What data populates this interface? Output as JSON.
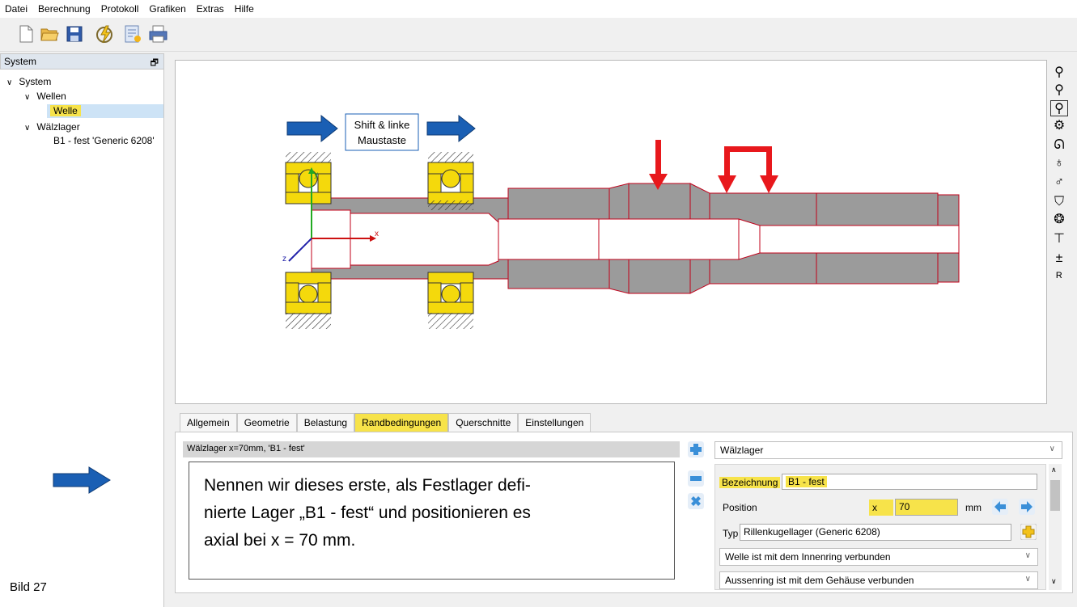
{
  "menu": [
    "Datei",
    "Berechnung",
    "Protokoll",
    "Grafiken",
    "Extras",
    "Hilfe"
  ],
  "toolbar_icons": [
    "new-file-icon",
    "open-folder-icon",
    "save-icon",
    "calculate-icon",
    "report-icon",
    "print-icon"
  ],
  "tree": {
    "panel_title": "System",
    "root": "System",
    "wellen": "Wellen",
    "welle": "Welle",
    "waelzlager": "Wälzlager",
    "bearing_item": "B1 - fest 'Generic 6208'"
  },
  "canvas": {
    "hint_line1": "Shift & linke",
    "hint_line2": "Maustaste",
    "axis_x": "x",
    "axis_y": "y",
    "axis_z": "z"
  },
  "right_tools": [
    "zoom-in-icon",
    "zoom-out-icon",
    "zoom-window-icon",
    "gear-icon",
    "bearing-icon",
    "force-icon",
    "moment-icon",
    "support-icon",
    "ball-bearing-icon",
    "section-icon",
    "coupling-icon",
    "results-icon"
  ],
  "tabs": [
    "Allgemein",
    "Geometrie",
    "Belastung",
    "Randbedingungen",
    "Querschnitte",
    "Einstellungen"
  ],
  "active_tab": "Randbedingungen",
  "list_header": "Wälzlager  x=70mm, 'B1 - fest'",
  "note_text": [
    "Nennen wir dieses erste, als Festlager defi-",
    "nierte Lager „B1 - fest“ und positionieren es",
    "axial bei x = 70 mm."
  ],
  "element_type": "Wälzlager",
  "form": {
    "bezeichnung_label": "Bezeichnung",
    "bezeichnung_value": "B1 - fest",
    "position_label": "Position",
    "x_label": "x",
    "x_value": "70",
    "unit": "mm",
    "typ_label": "Typ",
    "typ_value": "Rillenkugellager (Generic 6208)",
    "inner_option": "Welle ist mit dem Innenring verbunden",
    "outer_option": "Aussenring ist mit dem Gehäuse verbunden"
  },
  "caption": "Bild 27",
  "colors": {
    "highlight": "#f7e34a",
    "arrow_blue": "#1a5fb4",
    "load_red": "#e8181c",
    "shaft_gray": "#9b9b9b",
    "bearing_yellow": "#f4d90c"
  }
}
